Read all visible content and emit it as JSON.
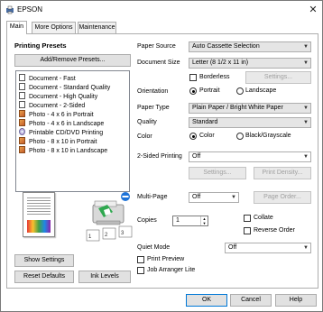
{
  "window": {
    "title": "EPSON"
  },
  "tabs": [
    {
      "label": "Main",
      "active": true
    },
    {
      "label": "More Options",
      "active": false
    },
    {
      "label": "Maintenance",
      "active": false
    }
  ],
  "presets": {
    "title": "Printing Presets",
    "add_remove_label": "Add/Remove Presets...",
    "items": [
      {
        "label": "Document - Fast",
        "icon": "document-icon"
      },
      {
        "label": "Document - Standard Quality",
        "icon": "document-icon"
      },
      {
        "label": "Document - High Quality",
        "icon": "document-icon"
      },
      {
        "label": "Document - 2-Sided",
        "icon": "document-icon"
      },
      {
        "label": "Photo - 4 x 6 in Portrait",
        "icon": "photo-icon"
      },
      {
        "label": "Photo - 4 x 6 in Landscape",
        "icon": "photo-icon"
      },
      {
        "label": "Printable CD/DVD Printing",
        "icon": "cd-icon"
      },
      {
        "label": "Photo - 8 x 10 in Portrait",
        "icon": "photo-icon"
      },
      {
        "label": "Photo - 8 x 10 in Landscape",
        "icon": "photo-icon"
      }
    ]
  },
  "left_buttons": {
    "show_settings": "Show Settings",
    "reset_defaults": "Reset Defaults",
    "ink_levels": "Ink Levels"
  },
  "settings": {
    "paper_source_label": "Paper Source",
    "paper_source_value": "Auto Cassette Selection",
    "document_size_label": "Document Size",
    "document_size_value": "Letter (8 1/2 x 11 in)",
    "borderless_label": "Borderless",
    "borderless_settings": "Settings...",
    "orientation_label": "Orientation",
    "portrait_label": "Portrait",
    "landscape_label": "Landscape",
    "paper_type_label": "Paper Type",
    "paper_type_value": "Plain Paper / Bright White Paper",
    "quality_label": "Quality",
    "quality_value": "Standard",
    "color_label": "Color",
    "color_option": "Color",
    "grayscale_option": "Black/Grayscale",
    "two_sided_label": "2-Sided Printing",
    "two_sided_value": "Off",
    "two_sided_settings": "Settings...",
    "print_density": "Print Density...",
    "multipage_label": "Multi-Page",
    "multipage_value": "Off",
    "page_order": "Page Order...",
    "copies_label": "Copies",
    "copies_value": "1",
    "collate_label": "Collate",
    "reverse_order_label": "Reverse Order",
    "quiet_mode_label": "Quiet Mode",
    "quiet_mode_value": "Off",
    "print_preview_label": "Print Preview",
    "job_arranger_label": "Job Arranger Lite"
  },
  "footer": {
    "ok": "OK",
    "cancel": "Cancel",
    "help": "Help"
  }
}
